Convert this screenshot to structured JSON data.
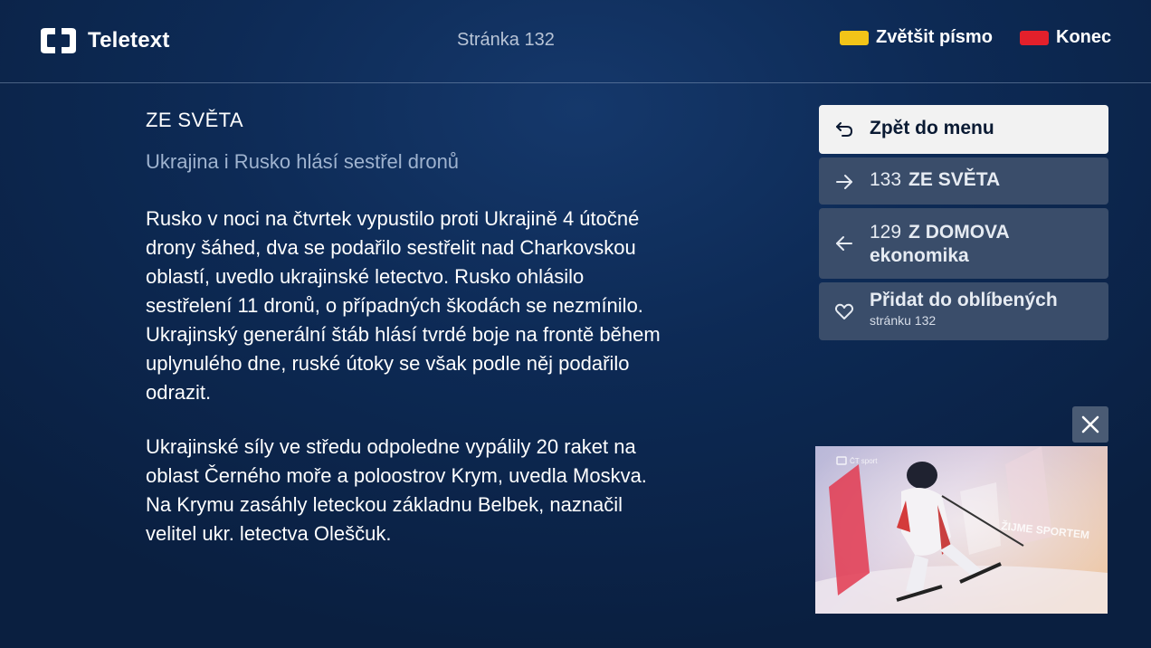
{
  "header": {
    "app_title": "Teletext",
    "page_label": "Stránka 132",
    "hotkeys": [
      {
        "label": "Zvětšit písmo",
        "color": "#f2c418"
      },
      {
        "label": "Konec",
        "color": "#e3202b"
      }
    ]
  },
  "article": {
    "section": "ZE SVĚTA",
    "headline": "Ukrajina i Rusko hlásí sestřel dronů",
    "paragraphs": [
      "Rusko v noci na čtvrtek vypustilo proti Ukrajině 4 útočné drony šáhed, dva se podařilo sestřelit nad Charkovskou oblastí, uvedlo ukrajinské letectvo. Rusko ohlásilo sestřelení 11 dronů, o případných škodách se nezmínilo. Ukrajinský generální štáb hlásí tvrdé boje na frontě během uplynulého dne, ruské útoky se však podle něj podařilo odrazit.",
      "Ukrajinské síly ve středu odpoledne vypálily 20 raket na oblast Černého moře a poloostrov Krym, uvedla Moskva. Na Krymu zasáhly leteckou základnu Belbek, naznačil velitel ukr. letectva Oleščuk."
    ]
  },
  "nav": {
    "back": {
      "label": "Zpět do menu",
      "icon": "return-arrow-icon"
    },
    "next": {
      "page": "133",
      "label": "ZE SVĚTA",
      "icon": "arrow-right-icon"
    },
    "prev": {
      "page": "129",
      "label": "Z DOMOVA",
      "label2": "ekonomika",
      "icon": "arrow-left-icon"
    },
    "favorite": {
      "label": "Přidat do oblíbených",
      "sub": "stránku 132",
      "icon": "heart-icon"
    }
  },
  "video": {
    "watermark": "ŽIJME SPORTEM",
    "channel": "ČT sport"
  },
  "colors": {
    "background": "#0d2a55",
    "nav_item": "#3a4d6a",
    "headline": "#9fb3cf"
  }
}
